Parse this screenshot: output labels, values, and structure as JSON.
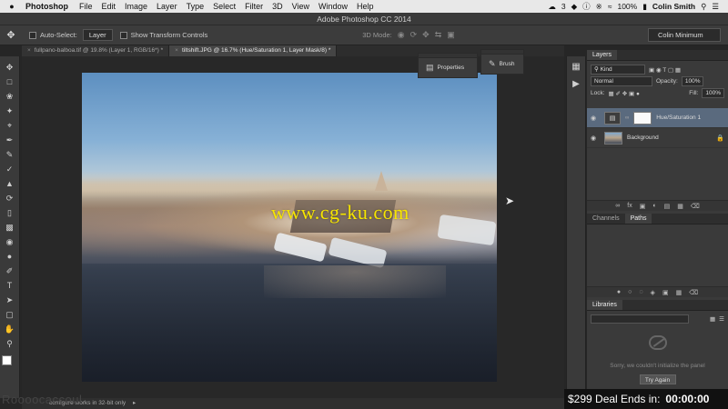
{
  "menubar": {
    "app_name": "Photoshop",
    "items": [
      "File",
      "Edit",
      "Image",
      "Layer",
      "Type",
      "Select",
      "Filter",
      "3D",
      "View",
      "Window",
      "Help"
    ],
    "badge": "3",
    "battery": "100%",
    "user": "Colin Smith"
  },
  "window": {
    "title": "Adobe Photoshop CC 2014"
  },
  "options": {
    "auto_select_label": "Auto-Select:",
    "auto_select_value": "Layer",
    "transform_label": "Show Transform Controls",
    "mode_label": "3D Mode:",
    "workspace": "Colin Minimum"
  },
  "tabs": [
    {
      "label": "fullpano-balboa.tif @ 19.8% (Layer 1, RGB/16*) *"
    },
    {
      "label": "tiltshift.JPG @ 16.7% (Hue/Saturation 1, Layer Mask/8) *"
    }
  ],
  "floating": {
    "properties": "Properties",
    "brush": "Brush"
  },
  "watermark": "www.cg-ku.com",
  "layers_panel": {
    "tab": "Layers",
    "filter": "Kind",
    "blend_mode": "Normal",
    "opacity_label": "Opacity:",
    "opacity_value": "100%",
    "lock_label": "Lock:",
    "fill_label": "Fill:",
    "fill_value": "100%",
    "layers": [
      {
        "name": "Hue/Saturation 1"
      },
      {
        "name": "Background"
      }
    ]
  },
  "lower_tabs": {
    "channels": "Channels",
    "paths": "Paths"
  },
  "libraries": {
    "tab": "Libraries",
    "message": "Sorry, we couldn't initialize the panel",
    "button": "Try Again"
  },
  "status": {
    "text": "configure works in 32-bit only"
  },
  "brand": "Roooocaccoul",
  "promo": {
    "text": "$299 Deal Ends in:",
    "timer": "00:00:00"
  }
}
